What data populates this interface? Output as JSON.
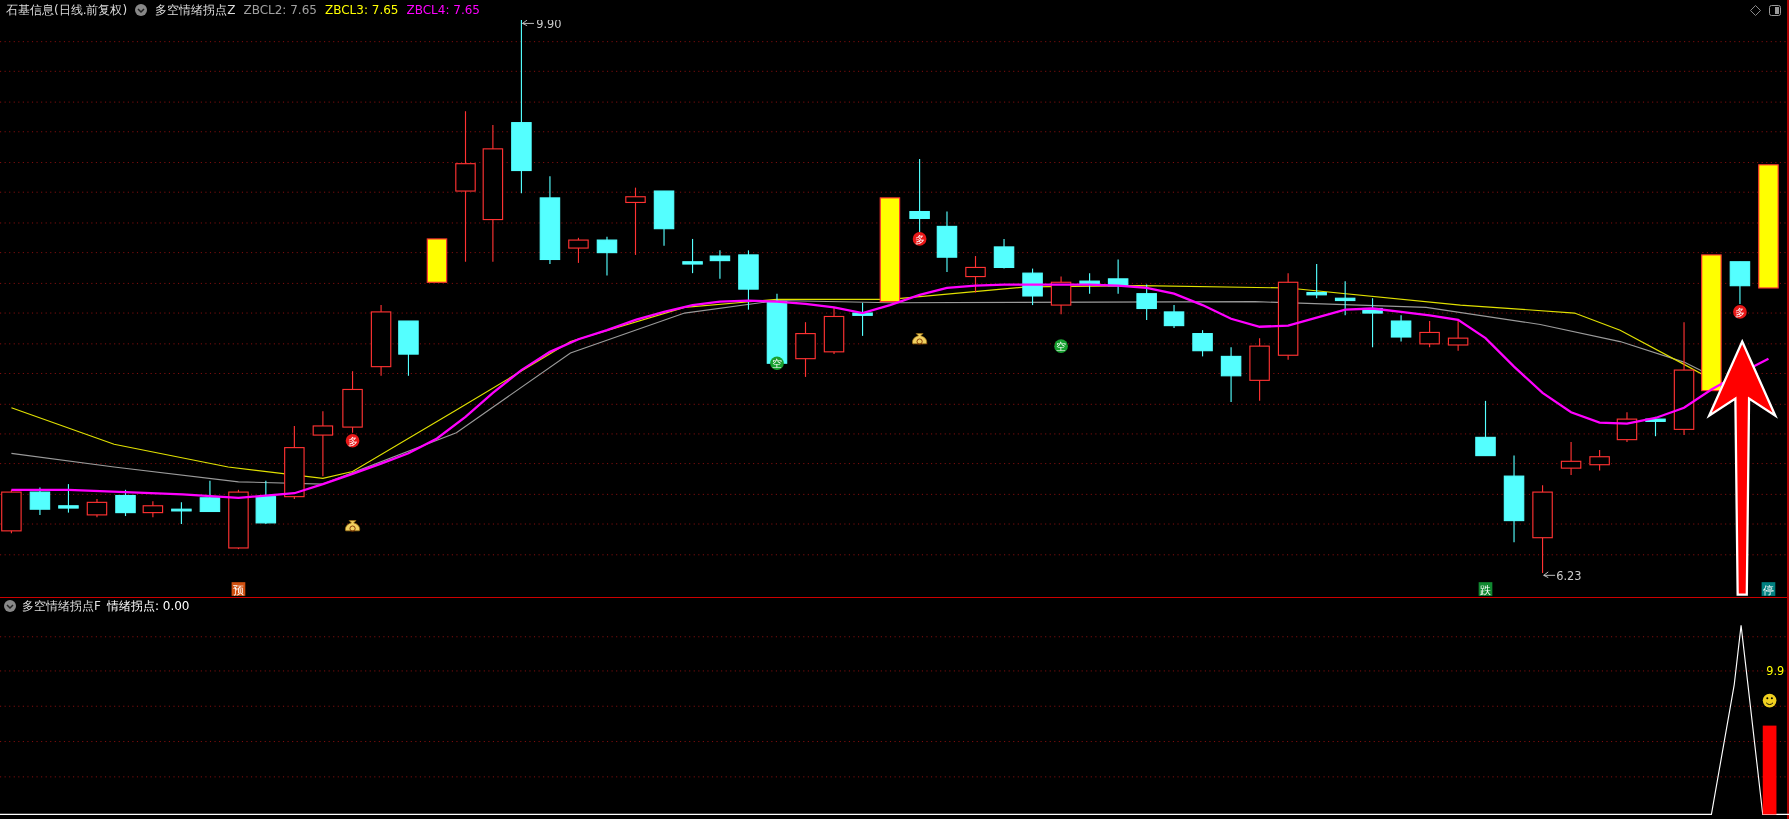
{
  "header": {
    "title": "石基信息(日线.前复权)",
    "indicator": "多空情绪拐点Z",
    "values": [
      {
        "label": "ZBCL2: 7.65",
        "color": "#a0a0a0"
      },
      {
        "label": "ZBCL3: 7.65",
        "color": "#ffff00"
      },
      {
        "label": "ZBCL4: 7.65",
        "color": "#ff00ff"
      }
    ]
  },
  "main_chart": {
    "high_label": "9.90",
    "low_label": "6.23",
    "signals": [
      {
        "kind": "bull",
        "text": "多"
      },
      {
        "kind": "bull",
        "text": "多"
      },
      {
        "kind": "bull",
        "text": "多"
      },
      {
        "kind": "bear",
        "text": "空"
      },
      {
        "kind": "bear",
        "text": "空"
      }
    ],
    "tags": [
      {
        "text": "预",
        "color": "#d05010"
      },
      {
        "text": "跌",
        "color": "#108830"
      },
      {
        "text": "停",
        "color": "#008080"
      }
    ]
  },
  "sub_chart": {
    "title": "多空情绪拐点F",
    "reading": "情绪拐点: 0.00",
    "price_label": "9.9"
  }
}
